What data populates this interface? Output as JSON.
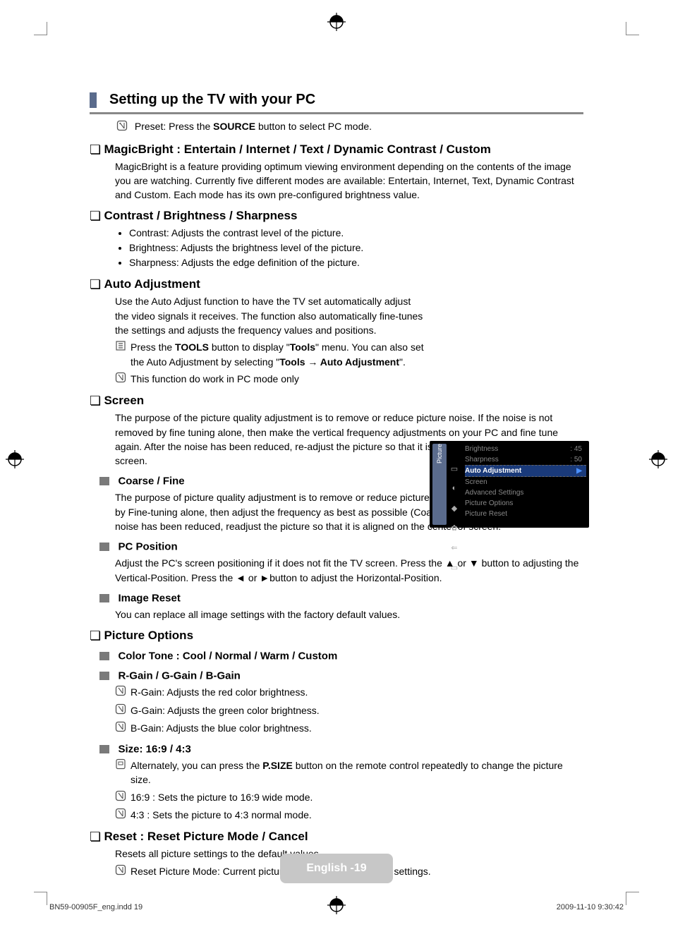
{
  "heading": "Setting up the TV with your PC",
  "preset_prefix": "Preset: Press the ",
  "preset_bold": "SOURCE",
  "preset_suffix": " button to select PC mode.",
  "magicbright": {
    "title": "MagicBright : Entertain / Internet / Text / Dynamic Contrast / Custom",
    "body": "MagicBright is a feature providing optimum viewing environment depending on the contents of the image you are watching. Currently five different modes are available: Entertain, Internet, Text, Dynamic Contrast and Custom. Each mode has its own pre-configured brightness value."
  },
  "cbs": {
    "title": "Contrast / Brightness / Sharpness",
    "items": [
      "Contrast: Adjusts the contrast level of the picture.",
      "Brightness: Adjusts the brightness level of the picture.",
      "Sharpness: Adjusts the edge definition of the picture."
    ]
  },
  "auto": {
    "title": "Auto Adjustment",
    "body": "Use the Auto Adjust function to have the TV set automatically adjust the video signals it receives. The function also automatically fine-tunes the settings and adjusts the frequency values and positions.",
    "tools_prefix": "Press the ",
    "tools_b1": "TOOLS",
    "tools_mid1": " button to display \"",
    "tools_b2": "Tools",
    "tools_mid2": "\" menu. You can also set the Auto Adjustment by selecting \"",
    "tools_b3": "Tools → Auto Adjustment",
    "tools_suffix": "\".",
    "pc_only": "This function do work in PC mode only"
  },
  "screen": {
    "title": "Screen",
    "body": "The purpose of the picture quality adjustment is to remove or reduce picture noise. If the noise is not removed by fine tuning alone, then make the vertical frequency adjustments on your PC and fine tune again. After the noise has been reduced, re-adjust the picture so that it is aligned on the center of the screen."
  },
  "coarse": {
    "title": "Coarse / Fine",
    "body": "The purpose of picture quality adjustment is to remove or reduce picture noise. If the noise is not removed by Fine-tuning alone, then adjust the frequency as best as possible (Coarse) and Fine-tune again. After the noise has been reduced, readjust the picture so that it is aligned on the center of screen."
  },
  "pcpos": {
    "title": "PC Position",
    "body": "Adjust the PC's screen positioning if it does not fit the TV screen. Press the ▲ or ▼ button to adjusting the Vertical-Position. Press the ◄ or ►button to adjust the Horizontal-Position."
  },
  "imgreset": {
    "title": "Image Reset",
    "body": "You can replace all image settings with the factory default values."
  },
  "picopts": {
    "title": "Picture Options"
  },
  "colortone": {
    "title": "Color Tone : Cool / Normal / Warm / Custom"
  },
  "gains": {
    "title": "R-Gain / G-Gain / B-Gain",
    "items": [
      "R-Gain: Adjusts the red color brightness.",
      "G-Gain: Adjusts the green color brightness.",
      "B-Gain: Adjusts the blue color brightness."
    ]
  },
  "size": {
    "title": "Size: 16:9 / 4:3",
    "alt_prefix": "Alternately, you can press the ",
    "alt_bold": "P.SIZE",
    "alt_suffix": " button on the remote control repeatedly to change the picture size.",
    "r169": "16:9 : Sets the picture to 16:9 wide mode.",
    "r43": "4:3 : Sets the picture to 4:3 normal mode."
  },
  "reset": {
    "title": "Reset : Reset Picture Mode / Cancel",
    "body": "Resets all picture settings to the default values.",
    "note": "Reset Picture Mode: Current picture values return to default settings."
  },
  "osd": {
    "side": "Picture",
    "brightness_l": "Brightness",
    "brightness_v": ": 45",
    "sharpness_l": "Sharpness",
    "sharpness_v": ": 50",
    "auto_l": "Auto Adjustment",
    "auto_arrow": "▶",
    "screen": "Screen",
    "advset": "Advanced Settings",
    "picopt": "Picture Options",
    "picreset": "Picture Reset"
  },
  "badge_lang": "English - ",
  "badge_num": "19",
  "footer_left": "BN59-00905F_eng.indd   19",
  "footer_right": "2009-11-10   9:30:42"
}
